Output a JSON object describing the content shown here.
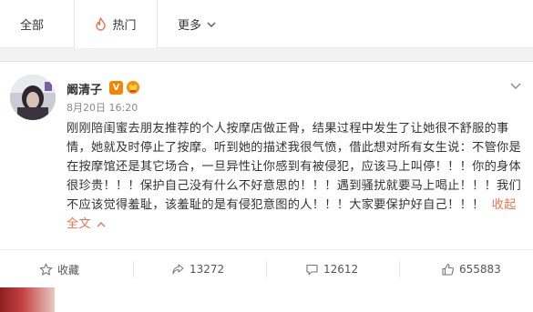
{
  "tabs": {
    "all": "全部",
    "hot": "热门",
    "more": "更多"
  },
  "post": {
    "username": "阚清子",
    "verified_badge": "V",
    "time": "8月20日 16:20",
    "text": "刚刚陪闺蜜去朋友推荐的个人按摩店做正骨，结果过程中发生了让她很不舒服的事情，她就及时停止了按摩。听到她的描述我很气愤，借此想对所有女生说：不管你是在按摩馆还是其它场合，一旦异性让你感到有被侵犯，应该马上叫停！！！你的身体很珍贵！！！保护自己没有什么不好意思的！！！遇到骚扰就要马上喝止！！！我们不应该觉得羞耻，该羞耻的是有侵犯意图的人！！！大家要保护好自己！！！",
    "collapse": "收起全文"
  },
  "actions": {
    "favorite": "收藏",
    "forward": "13272",
    "comment": "12612",
    "like": "655883"
  },
  "colors": {
    "accent": "#eb7350",
    "badge": "#f78400"
  }
}
